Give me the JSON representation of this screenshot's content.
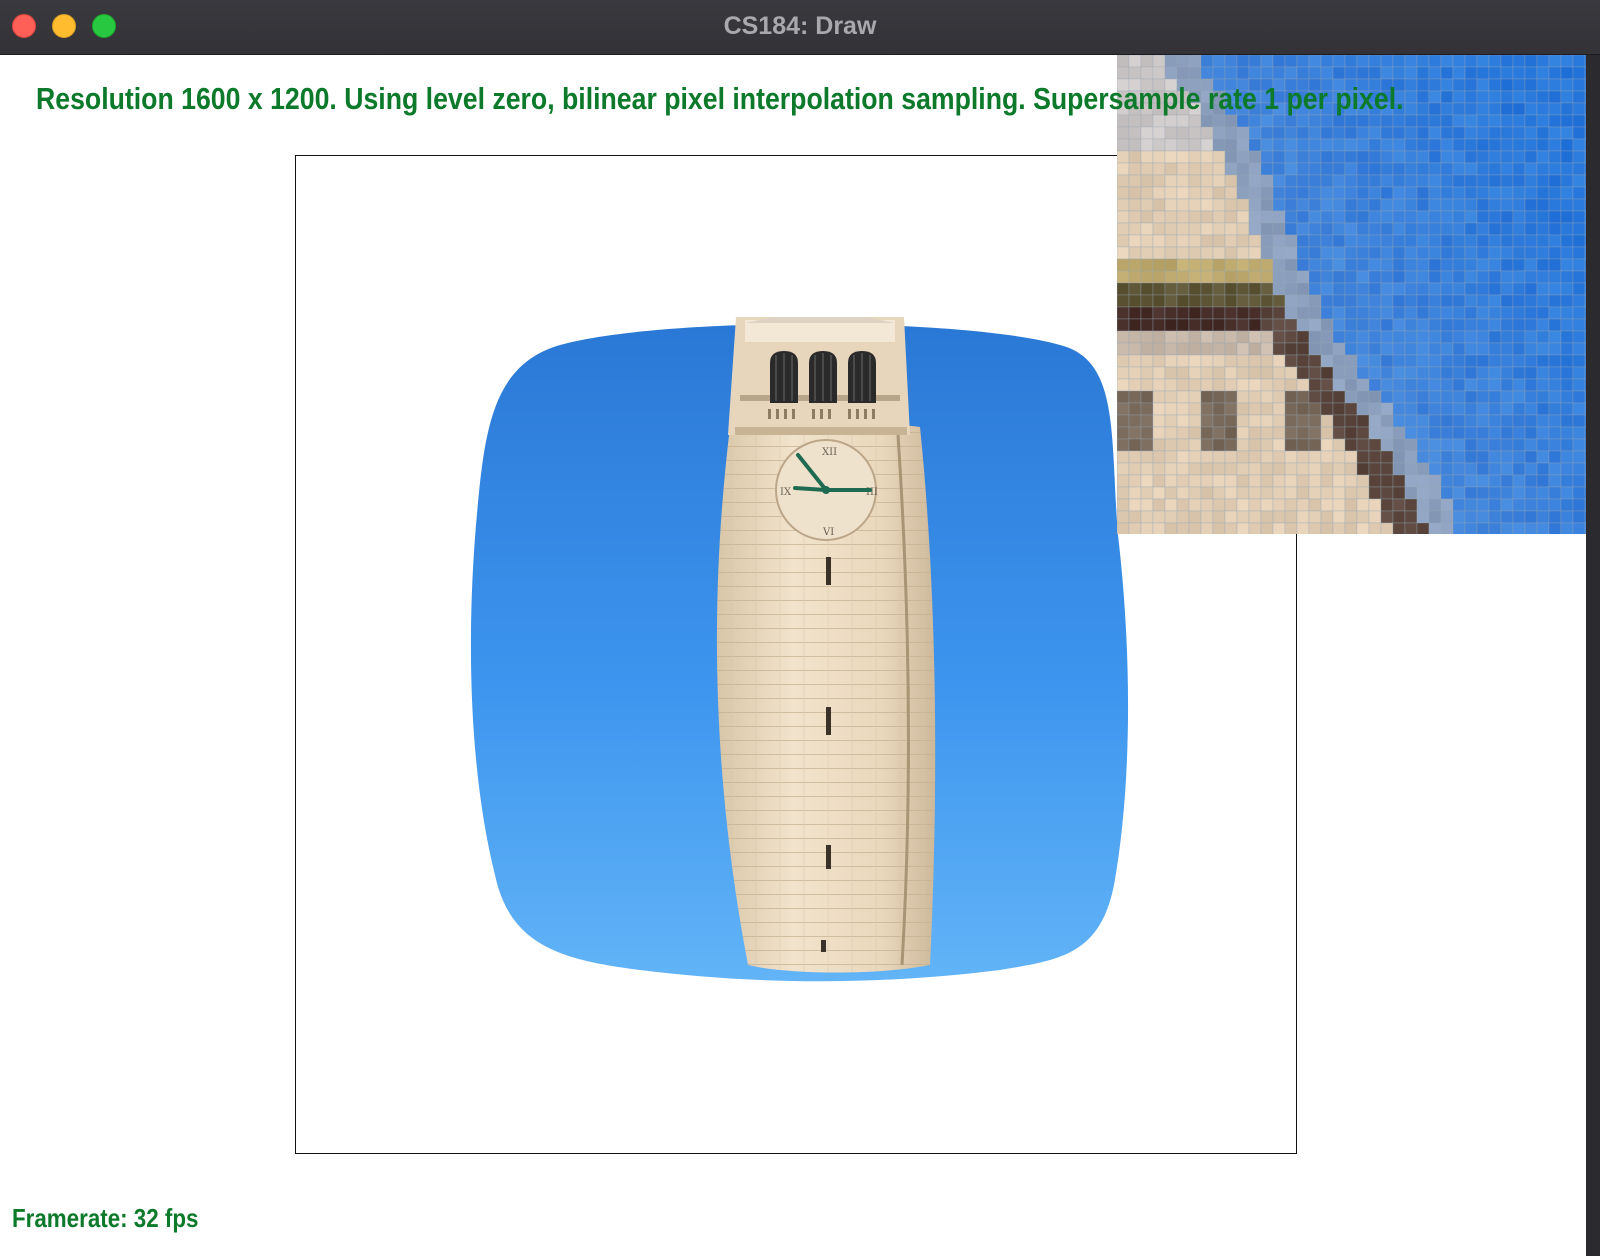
{
  "window": {
    "title": "CS184: Draw",
    "buttons": {
      "close": "close-button",
      "minimize": "minimize-button",
      "maximize": "maximize-button"
    }
  },
  "overlay": {
    "status_text": "Resolution 1600 x 1200. Using level zero, bilinear pixel interpolation sampling. Supersample rate 1 per pixel.",
    "framerate_text": "Framerate: 32 fps",
    "text_color": "#0c7a2a"
  },
  "render": {
    "subject": "bell tower against blue sky, warped texture",
    "sky_color_top": "#2f7fd8",
    "sky_color_bottom": "#5ab0f5",
    "tower_color": "#ead9c0",
    "zoom_grid_color": "#9aa7b4"
  }
}
